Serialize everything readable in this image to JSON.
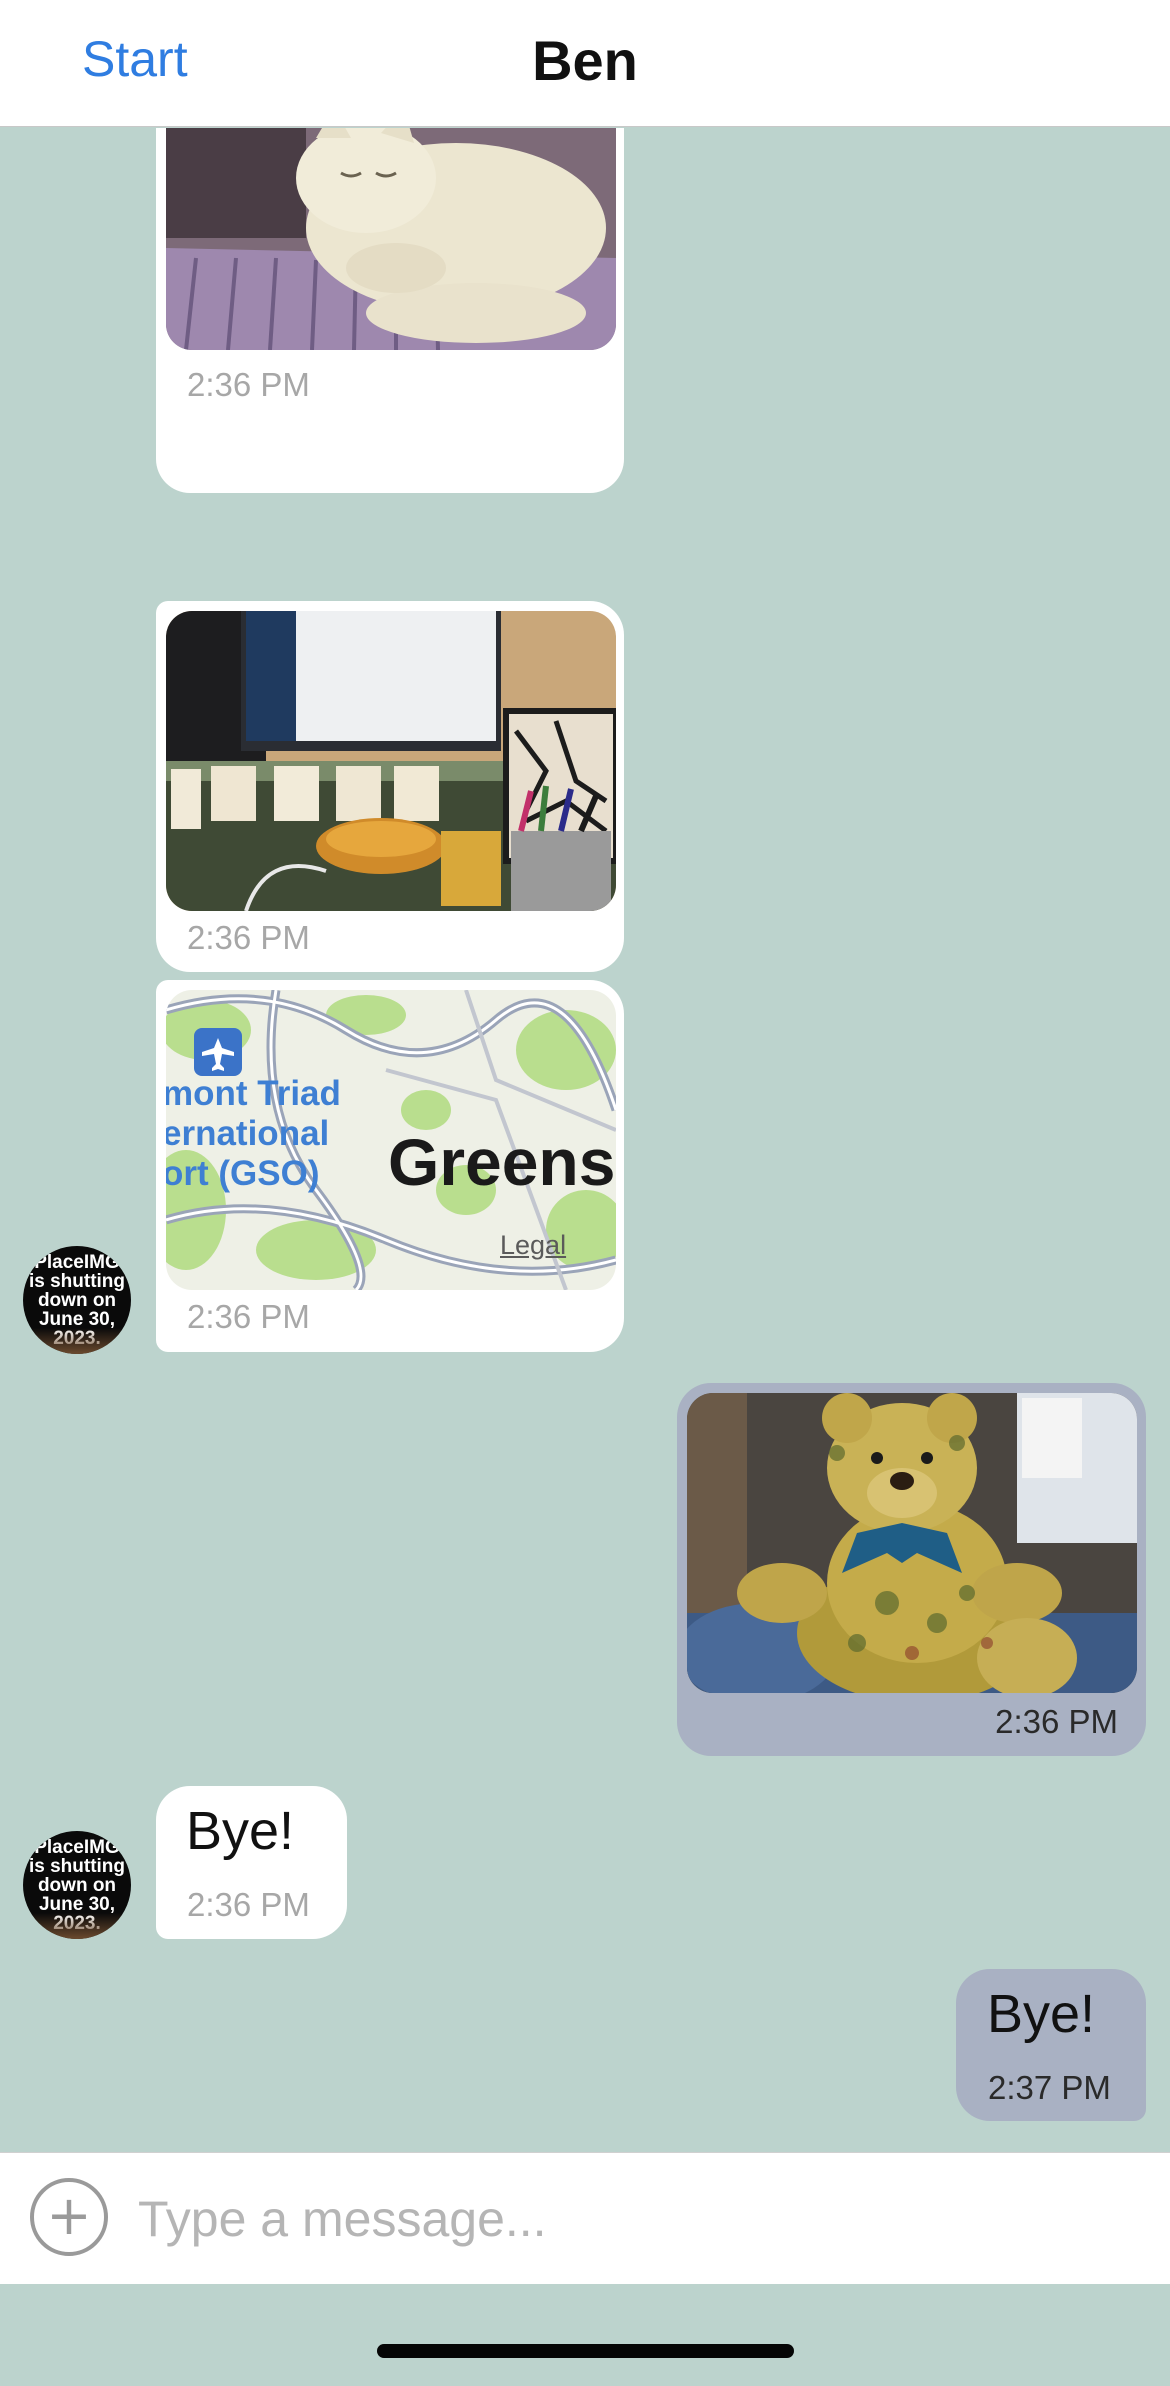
{
  "navbar": {
    "back_label": "Start",
    "title": "Ben"
  },
  "messages": [
    {
      "direction": "incoming",
      "kind": "image",
      "content": "cat-photo",
      "time": "2:36 PM"
    },
    {
      "direction": "incoming",
      "kind": "image",
      "content": "desk-photo",
      "time": "2:36 PM"
    },
    {
      "direction": "incoming",
      "kind": "location",
      "time": "2:36 PM",
      "map": {
        "label_airport": "mont Triad\nernational\nort (GSO)",
        "label_city": "Greens",
        "legal": "Legal"
      }
    },
    {
      "direction": "outgoing",
      "kind": "image",
      "content": "teddy-bear-photo",
      "time": "2:36 PM"
    },
    {
      "direction": "incoming",
      "kind": "text",
      "text": "Bye!",
      "time": "2:36 PM"
    },
    {
      "direction": "outgoing",
      "kind": "text",
      "text": "Bye!",
      "time": "2:37 PM"
    }
  ],
  "avatar": {
    "text": "PlaceIMG\nis shutting\ndown on\nJune 30,\n2023."
  },
  "composer": {
    "placeholder": "Type a message...",
    "value": "",
    "attach_icon": "plus-circle-icon"
  },
  "colors": {
    "background": "#bcd3cd",
    "accent": "#2f7de1",
    "incoming_bubble": "#ffffff",
    "outgoing_bubble": "#a9b1c3"
  }
}
